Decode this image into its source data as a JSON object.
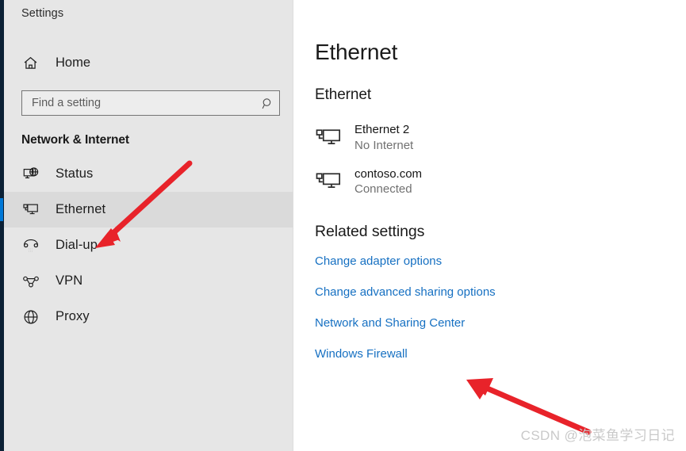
{
  "window": {
    "app_title": "Settings",
    "accent_color": "#0078d7",
    "sidebar_bg": "#e6e6e6",
    "edge_strip_color": "#0b2035"
  },
  "sidebar": {
    "home": {
      "label": "Home",
      "icon": "home-icon"
    },
    "search": {
      "placeholder": "Find a setting",
      "value": "",
      "icon": "search-icon"
    },
    "section_header": "Network & Internet",
    "items": [
      {
        "label": "Status",
        "icon": "globe-monitor-icon",
        "selected": false
      },
      {
        "label": "Ethernet",
        "icon": "ethernet-monitor-icon",
        "selected": true
      },
      {
        "label": "Dial-up",
        "icon": "phone-handset-icon",
        "selected": false
      },
      {
        "label": "VPN",
        "icon": "vpn-connector-icon",
        "selected": false
      },
      {
        "label": "Proxy",
        "icon": "globe-icon",
        "selected": false
      }
    ]
  },
  "main": {
    "page_title": "Ethernet",
    "section_title": "Ethernet",
    "adapters": [
      {
        "name": "Ethernet 2",
        "status": "No Internet",
        "icon": "ethernet-monitor-icon"
      },
      {
        "name": "contoso.com",
        "status": "Connected",
        "icon": "ethernet-monitor-icon"
      }
    ],
    "related_settings": {
      "heading": "Related settings",
      "link_color": "#1670c2",
      "links": [
        {
          "label": "Change adapter options"
        },
        {
          "label": "Change advanced sharing options"
        },
        {
          "label": "Network and Sharing Center"
        },
        {
          "label": "Windows Firewall"
        }
      ]
    }
  },
  "annotations": {
    "arrow_color": "#e8232a",
    "arrows": [
      {
        "name": "arrow-to-ethernet-sidebar",
        "points_at": "Ethernet",
        "direction": "down-left"
      },
      {
        "name": "arrow-to-network-sharing-center",
        "points_at": "Network and Sharing Center",
        "direction": "up-left"
      }
    ]
  },
  "watermark": {
    "text": "CSDN @泡菜鱼学习日记"
  }
}
